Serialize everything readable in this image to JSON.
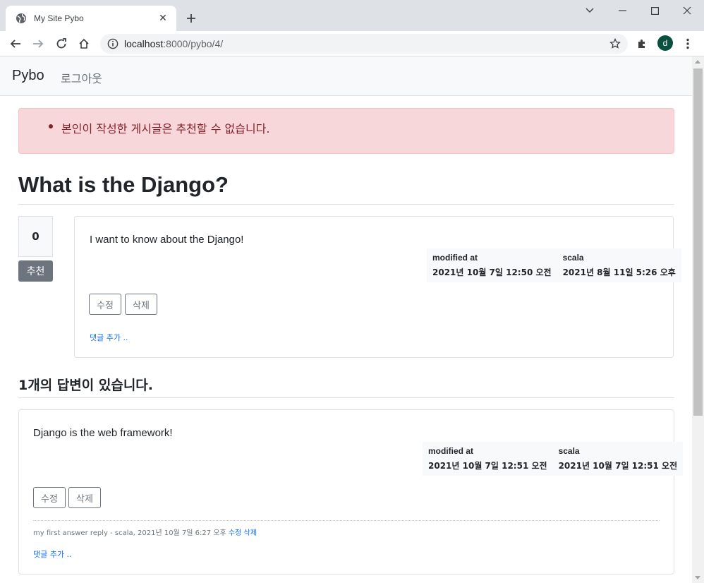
{
  "browser": {
    "tab_title": "My Site Pybo",
    "url_host": "localhost",
    "url_rest": ":8000/pybo/4/",
    "avatar_letter": "d"
  },
  "navbar": {
    "brand": "Pybo",
    "logout": "로그아웃"
  },
  "alert": {
    "message": "본인이 작성한 게시글은 추천할 수 없습니다."
  },
  "question": {
    "title": "What is the Django?",
    "vote_count": "0",
    "vote_label": "추천",
    "content": "I want to know about the Django!",
    "modified_label": "modified at",
    "modified_value": "2021년 10월 7일 12:50 오전",
    "author": "scala",
    "created_value": "2021년 8월 11일 5:26 오후",
    "edit_label": "수정",
    "delete_label": "삭제",
    "add_comment": "댓글 추가 .."
  },
  "answers": {
    "count": "1",
    "count_suffix": "개의 답변이 있습니다.",
    "items": [
      {
        "content": "Django is the web framework!",
        "modified_label": "modified at",
        "modified_value": "2021년 10월 7일 12:51 오전",
        "author": "scala",
        "created_value": "2021년 10월 7일 12:51 오전",
        "edit_label": "수정",
        "delete_label": "삭제",
        "comment_text": "my first answer reply - scala, 2021년 10월 7일 6:27 오후",
        "comment_edit": "수정",
        "comment_delete": "삭제",
        "add_comment": "댓글 추가 .."
      }
    ]
  },
  "colors": {
    "alert_bg": "#f8d7da",
    "alert_text": "#842029",
    "secondary": "#6c757d",
    "link": "#0d6efd"
  }
}
